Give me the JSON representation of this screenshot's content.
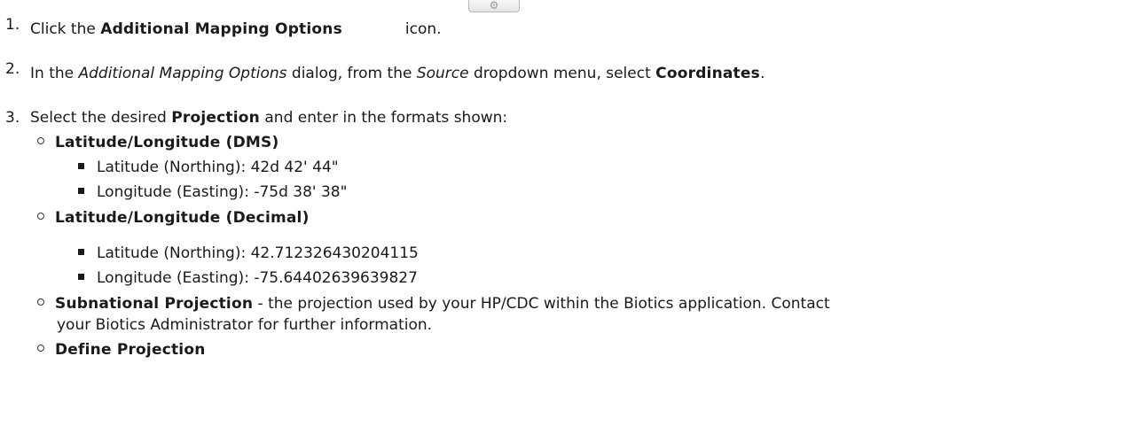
{
  "steps": [
    {
      "number": "1.",
      "prefix": "Click the ",
      "bold": "Additional Mapping Options",
      "suffix": "icon."
    },
    {
      "number": "2.",
      "prefix": "In the ",
      "italic1": "Additional Mapping Options",
      "middle1": " dialog, from the ",
      "italic2": "Source",
      "middle2": " dropdown menu, select ",
      "bold": "Coordinates",
      "suffix": "."
    },
    {
      "number": "3.",
      "prefix": "Select the desired ",
      "bold": "Projection",
      "suffix": " and enter in the formats shown:"
    }
  ],
  "projections": [
    {
      "name": "Latitude/Longitude (DMS)",
      "items": [
        "Latitude (Northing): 42d 42' 44\"",
        "Longitude (Easting): -75d 38' 38\""
      ]
    },
    {
      "name": "Latitude/Longitude (Decimal)",
      "items": [
        "Latitude (Northing): 42.712326430204115",
        "Longitude (Easting): -75.64402639639827"
      ]
    },
    {
      "name": "Subnational Projection",
      "description_line1": " - the projection used by your HP/CDC within the Biotics application. Contact",
      "description_line2": "your Biotics Administrator for further information."
    },
    {
      "name": "Define Projection"
    }
  ],
  "icons": {
    "mapping_options": "gear-icon"
  }
}
